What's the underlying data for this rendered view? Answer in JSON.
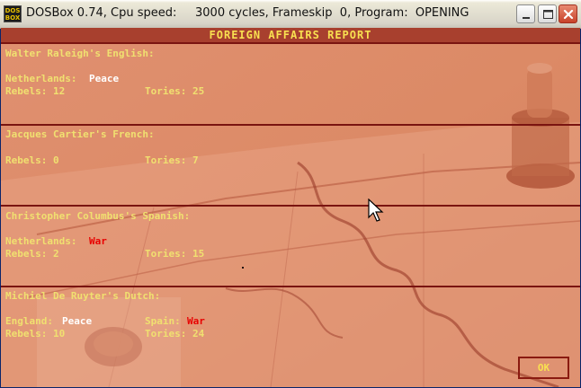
{
  "window": {
    "title": "DOSBox 0.74, Cpu speed:     3000 cycles, Frameskip  0, Program:  OPENING",
    "icon_text": "DOS BOX",
    "controls": [
      "minimize",
      "maximize",
      "close"
    ]
  },
  "report": {
    "title": "FOREIGN AFFAIRS REPORT",
    "ok_label": "OK",
    "colors": {
      "header": "#f0e070",
      "peace": "#ffffff",
      "war": "#e80000",
      "separator": "#7a1410"
    },
    "sections": [
      {
        "header": "Walter Raleigh's English:",
        "relations": [
          {
            "nation": "Netherlands:",
            "status": "Peace"
          }
        ],
        "rebels": "Rebels: 12",
        "tories": "Tories: 25"
      },
      {
        "header": "Jacques Cartier's French:",
        "relations": [],
        "rebels": "Rebels: 0",
        "tories": "Tories: 7"
      },
      {
        "header": "Christopher Columbus's Spanish:",
        "relations": [
          {
            "nation": "Netherlands:",
            "status": "War"
          }
        ],
        "rebels": "Rebels: 2",
        "tories": "Tories: 15"
      },
      {
        "header": "Michiel De Ruyter's Dutch:",
        "relations": [
          {
            "nation": "England:",
            "status": "Peace"
          },
          {
            "nation": "Spain:",
            "status": "War"
          }
        ],
        "rebels": "Rebels: 10",
        "tories": "Tories: 24"
      }
    ]
  }
}
